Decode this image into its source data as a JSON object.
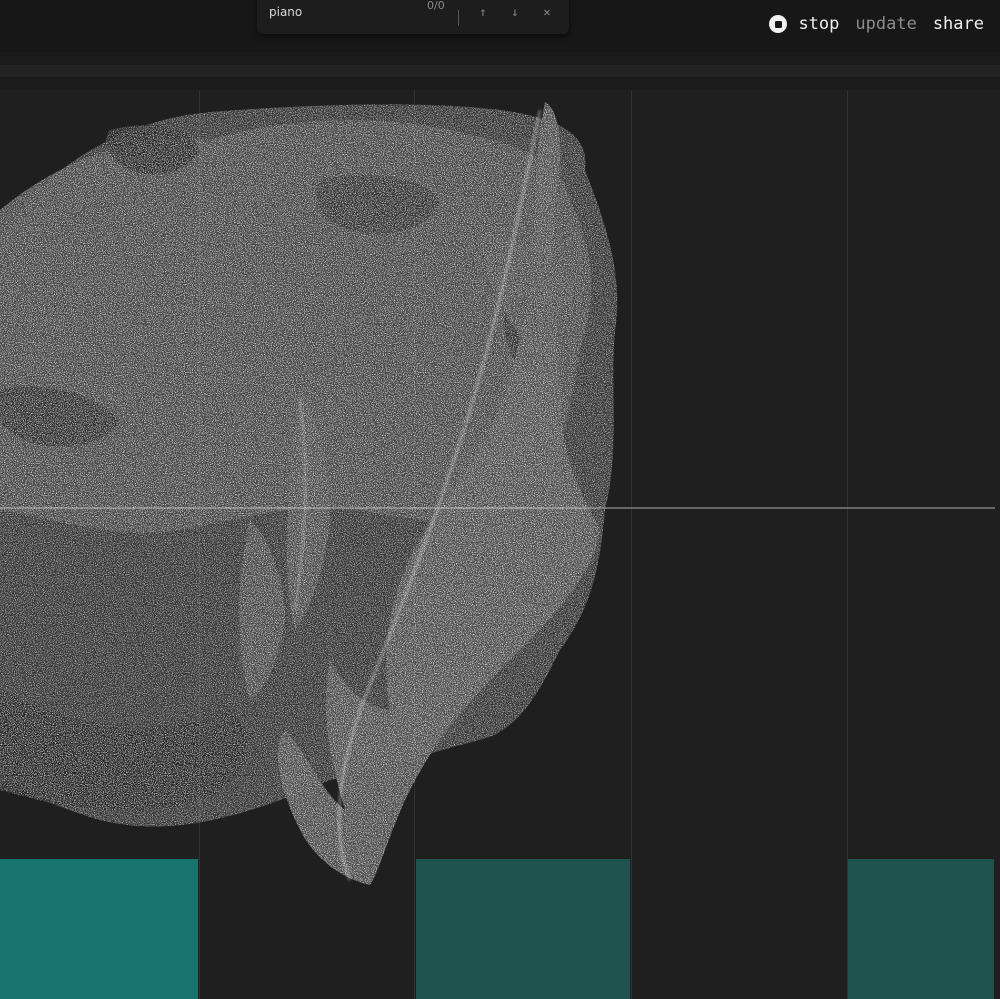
{
  "find": {
    "value": "piano",
    "count": "0/0",
    "prev_icon": "arrow-up-icon",
    "next_icon": "arrow-down-icon",
    "close_icon": "close-icon"
  },
  "toolbar": {
    "stop_label": "stop",
    "update_label": "update",
    "share_label": "share",
    "stop_icon": "stop-circle-icon"
  },
  "visualization": {
    "background_color": "#1f1f1f",
    "grid_line_color": "#2c3a37",
    "particle_color": "#c8c4c4",
    "horizontal_line_color": "#9a9a9a",
    "piano_roll_blocks": [
      {
        "column": 0,
        "color": "#16736e"
      },
      {
        "column": 2,
        "color": "#1d524f"
      },
      {
        "column": 4,
        "color": "#1d524f"
      }
    ]
  }
}
